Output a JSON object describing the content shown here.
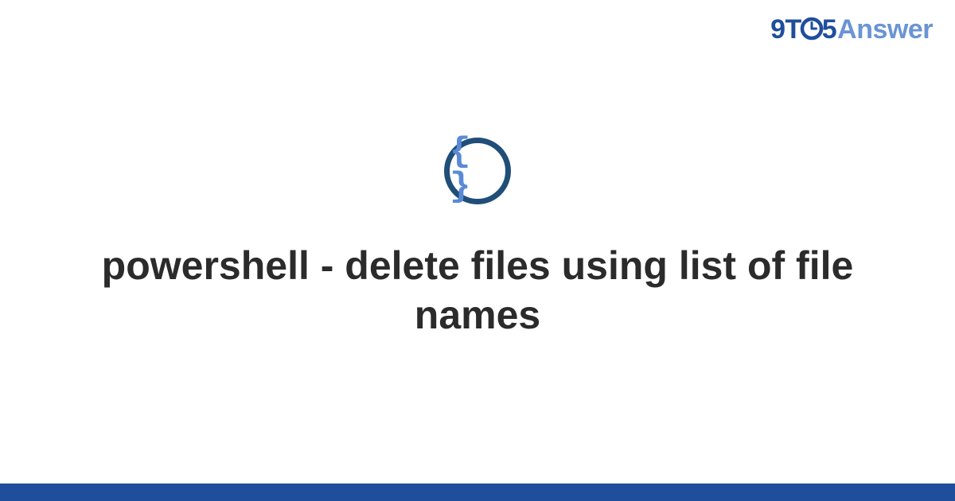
{
  "brand": {
    "part_9t": "9T",
    "part_5": "5",
    "part_answer": "Answer"
  },
  "badge": {
    "glyph": "{ }"
  },
  "page": {
    "title": "powershell - delete files using list of file names"
  },
  "colors": {
    "brand_dark": "#1f4e9c",
    "brand_light": "#6a94d4",
    "badge_ring": "#1f4e79",
    "badge_glyph": "#5a8ad6",
    "bottom_bar": "#1f4e9c"
  }
}
